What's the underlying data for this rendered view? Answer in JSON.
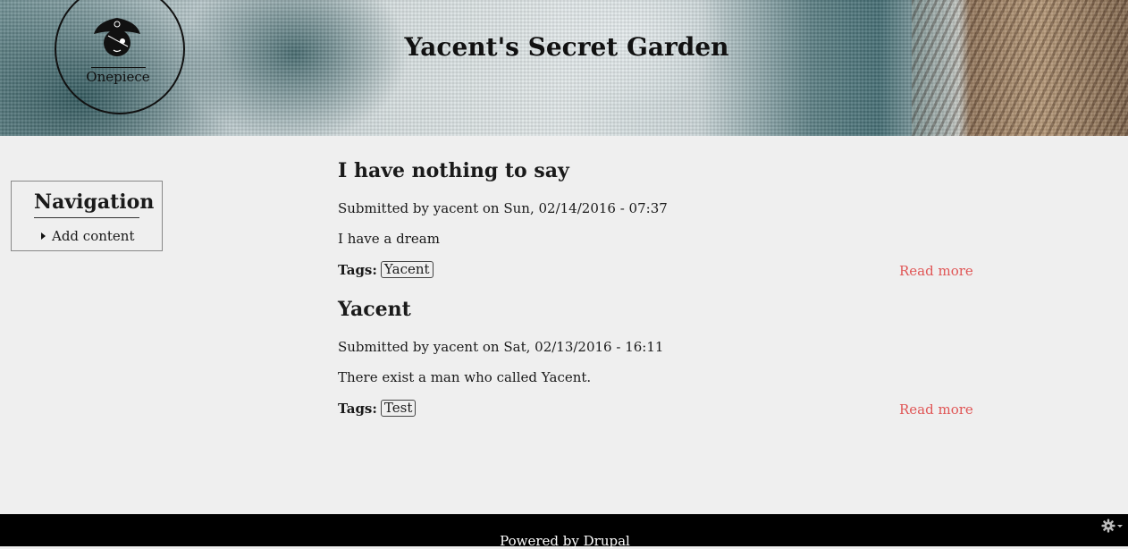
{
  "header": {
    "logo_text": "Onepiece",
    "site_title": "Yacent's Secret Garden"
  },
  "sidebar": {
    "title": "Navigation",
    "items": [
      {
        "label": "Add content"
      }
    ]
  },
  "articles": [
    {
      "title": "I have nothing to say",
      "submitted_prefix": "Submitted by",
      "author": "yacent",
      "date_text": "on Sun, 02/14/2016 - 07:37",
      "body": "I have a dream",
      "tags_label": "Tags:",
      "tags": [
        "Yacent"
      ],
      "read_more": "Read more"
    },
    {
      "title": "Yacent",
      "submitted_prefix": "Submitted by",
      "author": "yacent",
      "date_text": "on Sat, 02/13/2016 - 16:11",
      "body": "There exist a man who called Yacent.",
      "tags_label": "Tags:",
      "tags": [
        "Test"
      ],
      "read_more": "Read more"
    }
  ],
  "footer": {
    "text": "Powered by Drupal",
    "gear_icon": "gear-dropdown-icon"
  },
  "colors": {
    "link_accent": "#e05555",
    "footer_bg": "#000000",
    "page_bg": "#efefef"
  }
}
